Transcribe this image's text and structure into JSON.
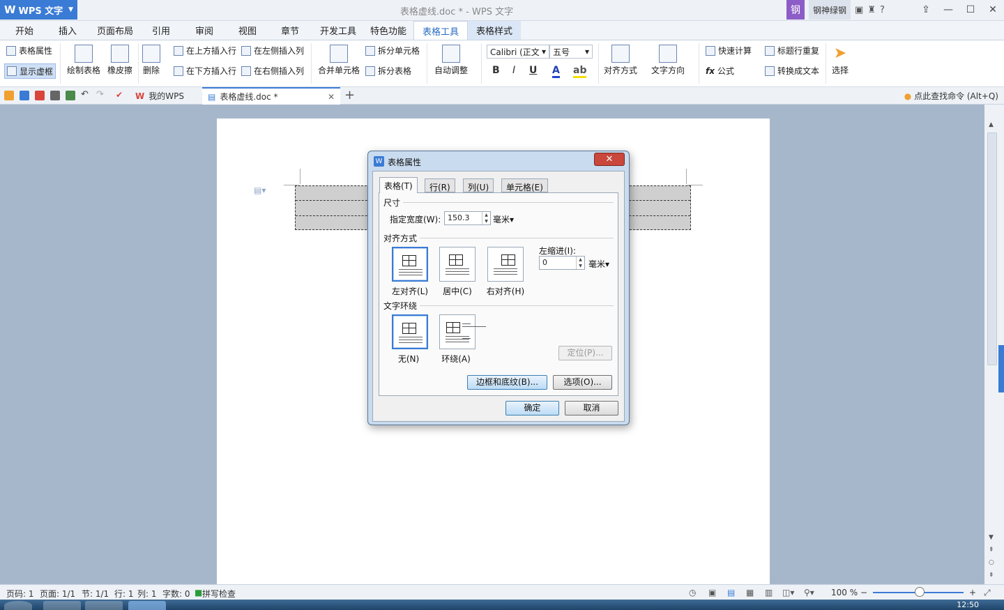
{
  "app": {
    "name": "WPS 文字",
    "window_title": "表格虚线.doc * - WPS 文字"
  },
  "user": {
    "avatar": "钢",
    "name": "钢神绿钢"
  },
  "menu_tabs": [
    "开始",
    "插入",
    "页面布局",
    "引用",
    "审阅",
    "视图",
    "章节",
    "开发工具",
    "特色功能",
    "表格工具",
    "表格样式"
  ],
  "ribbon": {
    "table_props": "表格属性",
    "show_gridlines": "显示虚框",
    "draw_table": "绘制表格",
    "eraser": "橡皮擦",
    "delete": "删除",
    "insert_row_above": "在上方插入行",
    "insert_row_below": "在下方插入行",
    "insert_col_left": "在左侧插入列",
    "insert_col_right": "在右侧插入列",
    "merge_cells": "合并单元格",
    "split_cells": "拆分单元格",
    "split_table": "拆分表格",
    "auto_fit": "自动调整",
    "font_name": "Calibri (正文",
    "font_size": "五号",
    "align": "对齐方式",
    "text_dir": "文字方向",
    "quick_calc": "快速计算",
    "repeat_header": "标题行重复",
    "formula": "公式",
    "convert_text": "转换成文本",
    "select": "选择"
  },
  "doc_tabs": {
    "my_wps": "我的WPS",
    "doc": "表格虚线.doc *"
  },
  "search_cmd": "点此查找命令 (Alt+Q)",
  "dialog": {
    "title": "表格属性",
    "tabs": [
      "表格(T)",
      "行(R)",
      "列(U)",
      "单元格(E)"
    ],
    "size_group": "尺寸",
    "width_label": "指定宽度(W):",
    "width_value": "150.3",
    "width_unit": "毫米",
    "align_group": "对齐方式",
    "align_left": "左对齐(L)",
    "align_center": "居中(C)",
    "align_right": "右对齐(H)",
    "indent_label": "左缩进(I):",
    "indent_value": "0",
    "indent_unit": "毫米",
    "wrap_group": "文字环绕",
    "wrap_none": "无(N)",
    "wrap_around": "环绕(A)",
    "position_btn": "定位(P)...",
    "borders_btn": "边框和底纹(B)...",
    "options_btn": "选项(O)...",
    "ok_btn": "确定",
    "cancel_btn": "取消"
  },
  "status": {
    "page_no": "页码: 1",
    "pages": "页面: 1/1",
    "section": "节: 1/1",
    "line": "行: 1",
    "col": "列: 1",
    "words": "字数: 0",
    "spell": "拼写检查",
    "zoom": "100 %"
  },
  "clock": "12:50"
}
